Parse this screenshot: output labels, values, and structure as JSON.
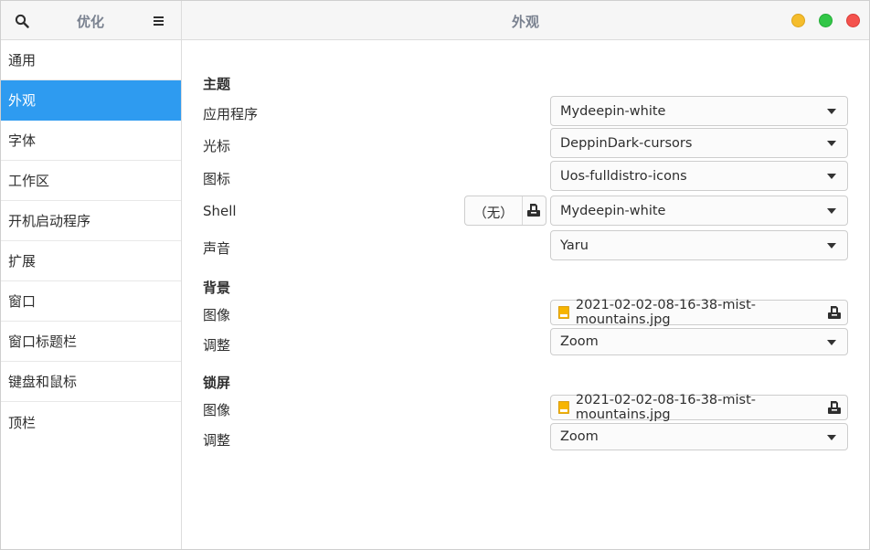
{
  "header": {
    "sidebar_title": "优化",
    "page_title": "外观",
    "search_icon": "search-icon",
    "menu_icon": "hamburger-menu-icon"
  },
  "sidebar": {
    "items": [
      {
        "label": "通用",
        "active": false
      },
      {
        "label": "外观",
        "active": true
      },
      {
        "label": "字体",
        "active": false
      },
      {
        "label": "工作区",
        "active": false
      },
      {
        "label": "开机启动程序",
        "active": false
      },
      {
        "label": "扩展",
        "active": false
      },
      {
        "label": "窗口",
        "active": false
      },
      {
        "label": "窗口标题栏",
        "active": false
      },
      {
        "label": "键盘和鼠标",
        "active": false
      },
      {
        "label": "顶栏",
        "active": false
      }
    ]
  },
  "theme": {
    "title": "主题",
    "applications_label": "应用程序",
    "applications_value": "Mydeepin-white",
    "cursor_label": "光标",
    "cursor_value": "DeppinDark-cursors",
    "icons_label": "图标",
    "icons_value": "Uos-fulldistro-icons",
    "shell_label": "Shell",
    "shell_file_value": "（无）",
    "shell_value": "Mydeepin-white",
    "sound_label": "声音",
    "sound_value": "Yaru"
  },
  "background": {
    "title": "背景",
    "image_label": "图像",
    "image_value": "2021-02-02-08-16-38-mist-mountains.jpg",
    "adjust_label": "调整",
    "adjust_value": "Zoom"
  },
  "lockscreen": {
    "title": "锁屏",
    "image_label": "图像",
    "image_value": "2021-02-02-08-16-38-mist-mountains.jpg",
    "adjust_label": "调整",
    "adjust_value": "Zoom"
  },
  "colors": {
    "accent": "#2e9bf0",
    "window_min": "#f5bd2c",
    "window_max": "#33c748",
    "window_close": "#f4524d"
  }
}
